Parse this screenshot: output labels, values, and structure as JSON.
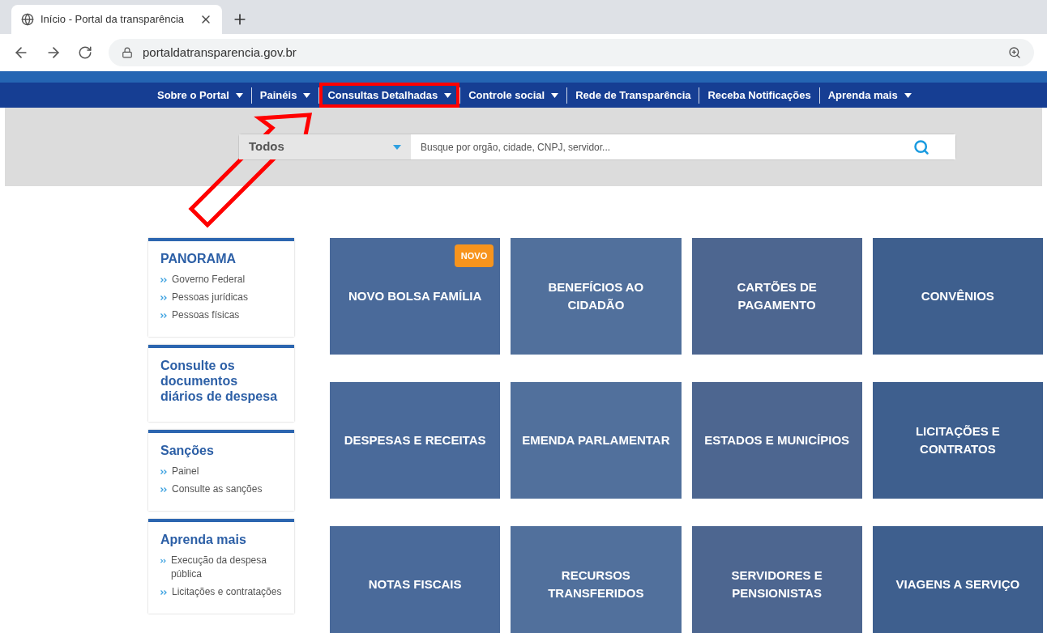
{
  "browser": {
    "tab_title": "Início - Portal da transparência",
    "url": "portaldatransparencia.gov.br"
  },
  "nav": [
    {
      "label": "Sobre o Portal",
      "dropdown": true,
      "highlighted": false
    },
    {
      "label": "Painéis",
      "dropdown": true,
      "highlighted": false
    },
    {
      "label": "Consultas Detalhadas",
      "dropdown": true,
      "highlighted": true
    },
    {
      "label": "Controle social",
      "dropdown": true,
      "highlighted": false
    },
    {
      "label": "Rede de Transparência",
      "dropdown": false,
      "highlighted": false
    },
    {
      "label": "Receba Notificações",
      "dropdown": false,
      "highlighted": false
    },
    {
      "label": "Aprenda mais",
      "dropdown": true,
      "highlighted": false
    }
  ],
  "search": {
    "scope": "Todos",
    "placeholder": "Busque por orgão, cidade, CNPJ, servidor..."
  },
  "sidebar": [
    {
      "title": "PANORAMA",
      "links": [
        "Governo Federal",
        "Pessoas jurídicas",
        "Pessoas físicas"
      ]
    },
    {
      "title": "Consulte os documentos diários de despesa"
    },
    {
      "title": "Sanções",
      "links": [
        "Painel",
        "Consulte as sanções"
      ]
    },
    {
      "title": "Aprenda mais",
      "links": [
        "Execução da despesa pública",
        "Licitações e contratações"
      ]
    }
  ],
  "tiles": [
    {
      "label": "NOVO BOLSA FAMÍLIA",
      "badge": "NOVO"
    },
    {
      "label": "BENEFÍCIOS AO CIDADÃO"
    },
    {
      "label": "CARTÕES DE PAGAMENTO"
    },
    {
      "label": "CONVÊNIOS"
    },
    {
      "label": "DESPESAS E RECEITAS"
    },
    {
      "label": "EMENDA PARLAMENTAR"
    },
    {
      "label": "ESTADOS E MUNICÍPIOS"
    },
    {
      "label": "LICITAÇÕES E CONTRATOS"
    },
    {
      "label": "NOTAS FISCAIS"
    },
    {
      "label": "RECURSOS TRANSFERIDOS"
    },
    {
      "label": "SERVIDORES E PENSIONISTAS"
    },
    {
      "label": "VIAGENS A SERVIÇO"
    }
  ]
}
